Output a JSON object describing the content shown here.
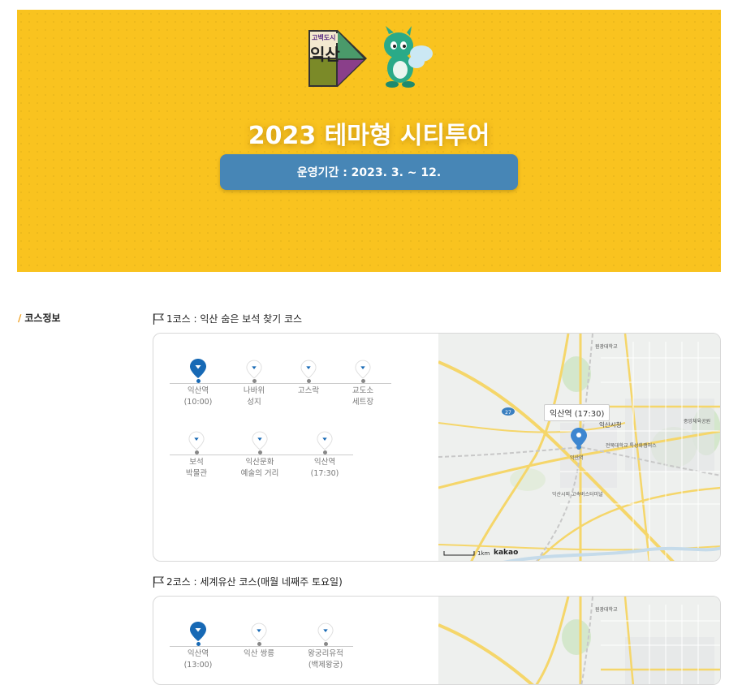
{
  "banner": {
    "logo_small": "고백도시",
    "logo_big": "익산",
    "title": "2023 테마형 시티투어",
    "period": "운영기간 : 2023. 3. ~ 12."
  },
  "section": {
    "label": "코스정보"
  },
  "courses": [
    {
      "title": "1코스 : 익산 숨은 보석 찾기 코스",
      "stops": [
        {
          "label": "익산역\n(10:00)",
          "active": true
        },
        {
          "label": "나바위\n성지",
          "active": false
        },
        {
          "label": "고스락",
          "active": false
        },
        {
          "label": "교도소\n세트장",
          "active": false
        },
        {
          "label": "보석\n박물관",
          "active": false
        },
        {
          "label": "익산문화\n예술의 거리",
          "active": false
        },
        {
          "label": "익산역\n(17:30)",
          "active": false
        }
      ],
      "map": {
        "tooltip": "익산역 (17:30)",
        "places": [
          "원광대학교",
          "익산시청",
          "중앙체육공원",
          "전북대학교\n특성화캠퍼스",
          "익산역",
          "익산시외\n고속버스터미널"
        ],
        "scale": "1km",
        "brand": "kakao"
      }
    },
    {
      "title": "2코스 : 세계유산 코스(매월 네째주 토요일)",
      "stops": [
        {
          "label": "익산역\n(13:00)",
          "active": true
        },
        {
          "label": "익산 쌍릉",
          "active": false
        },
        {
          "label": "왕궁리유적\n(백제왕궁)",
          "active": false
        }
      ],
      "map": {
        "places": [
          "원광대학교"
        ]
      }
    }
  ],
  "colors": {
    "banner": "#f9c31f",
    "period_bg": "#4786b6",
    "pin_active": "#1769b5"
  }
}
